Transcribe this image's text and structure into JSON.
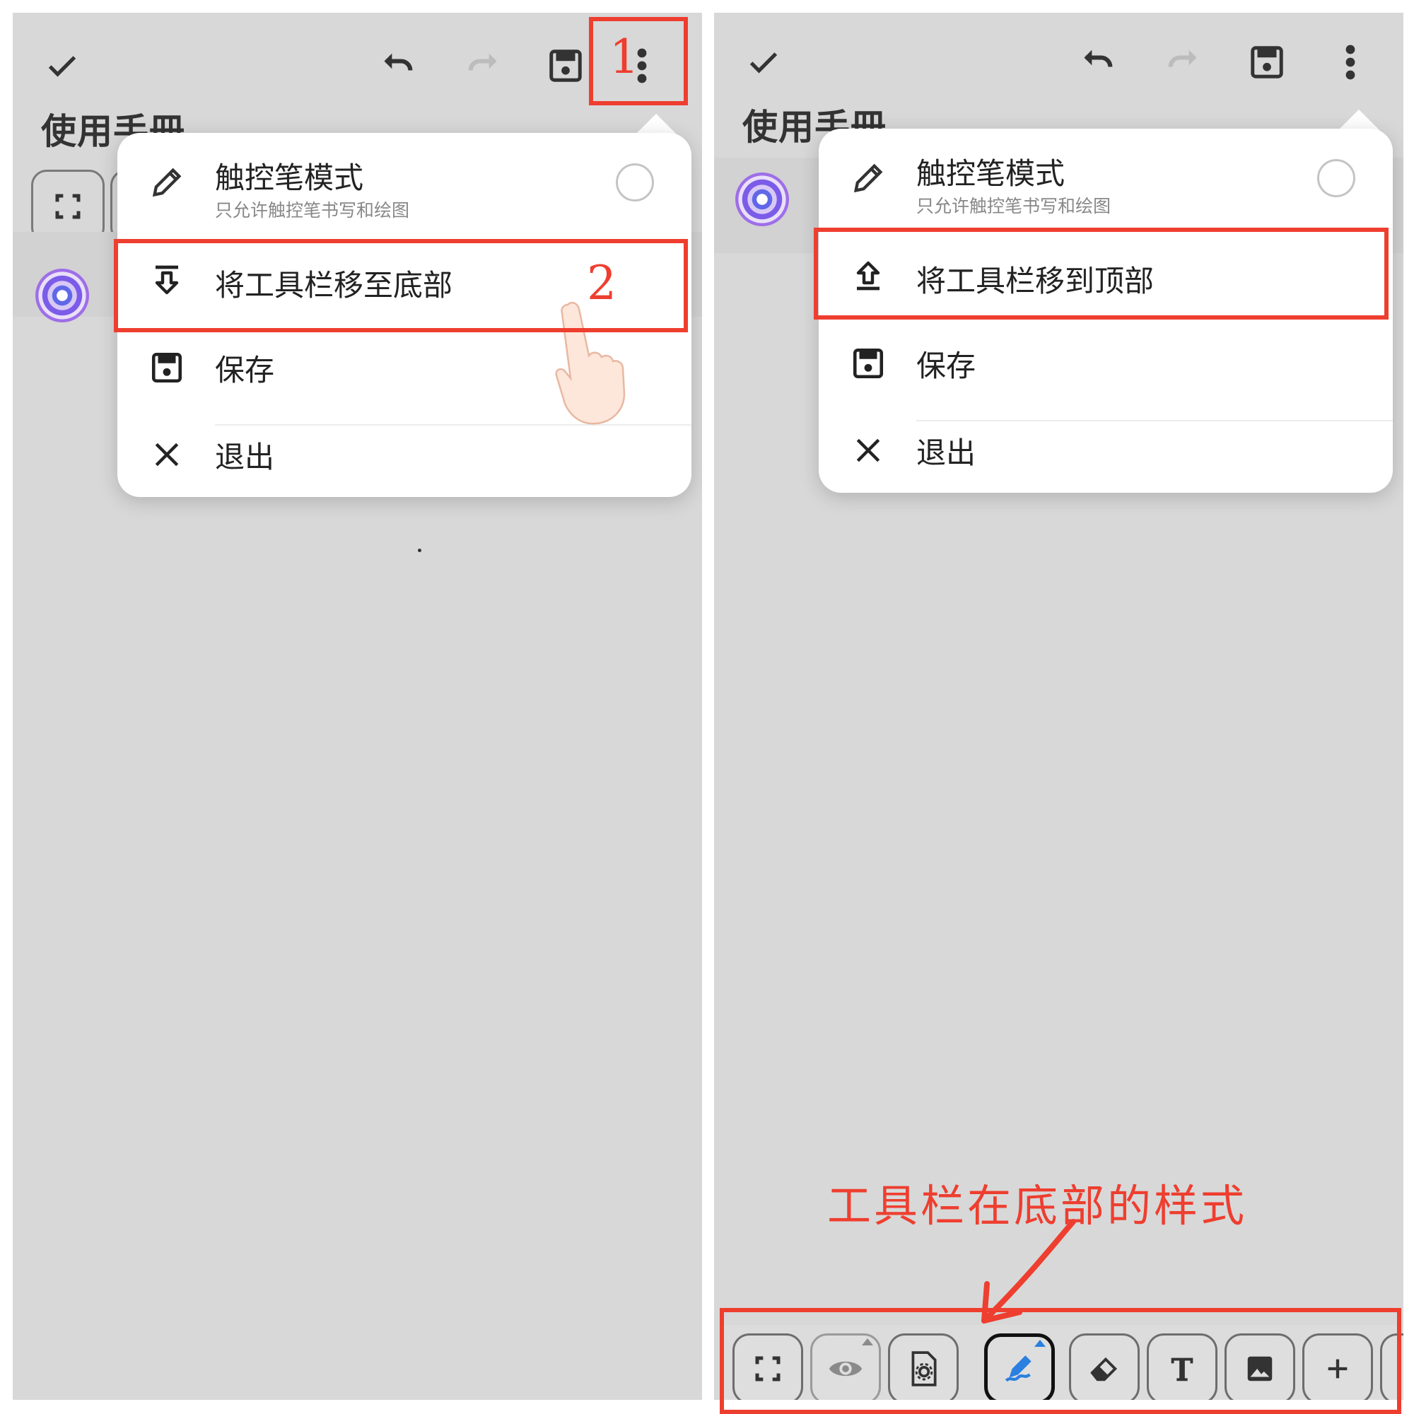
{
  "colors": {
    "highlight": "#ee3e2f",
    "panel_bg": "#d8d8d8",
    "menu_bg": "#ffffff",
    "accent_blue": "#2a7fe0"
  },
  "left": {
    "title": "使用手冊",
    "toolbar_icons": [
      "check-icon",
      "undo-icon",
      "redo-icon",
      "save-icon",
      "more-vert-icon"
    ],
    "step1": "1",
    "step2": "2",
    "menu": {
      "stylus": {
        "label": "触控笔模式",
        "desc": "只允许触控笔书写和绘图"
      },
      "move_toolbar": "将工具栏移至底部",
      "save": "保存",
      "exit": "退出"
    }
  },
  "right": {
    "title": "使用手冊",
    "menu": {
      "stylus": {
        "label": "触控笔模式",
        "desc": "只允许触控笔书写和绘图"
      },
      "move_toolbar": "将工具栏移到顶部",
      "save": "保存",
      "exit": "退出"
    },
    "bottom_toolbar": [
      "fullscreen-icon",
      "eye-icon",
      "settings-doc-icon",
      "pen-icon",
      "eraser-icon",
      "text-icon",
      "image-icon",
      "plus-icon"
    ],
    "caption": "工具栏在底部的样式"
  }
}
